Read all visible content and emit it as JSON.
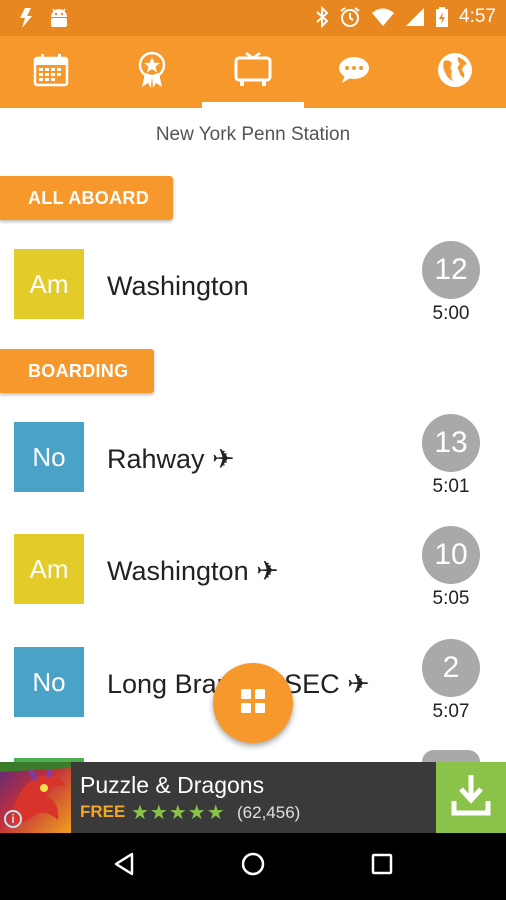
{
  "status_bar": {
    "time": "4:57",
    "left_icons": [
      "notification-icon",
      "android-icon"
    ],
    "right_icons": [
      "bluetooth-icon",
      "alarm-icon",
      "wifi-icon",
      "signal-icon",
      "battery-charging-icon"
    ]
  },
  "tabs": [
    {
      "icon": "calendar-icon",
      "active": false
    },
    {
      "icon": "badge-icon",
      "active": false
    },
    {
      "icon": "tv-icon",
      "active": true
    },
    {
      "icon": "chat-icon",
      "active": false
    },
    {
      "icon": "globe-icon",
      "active": false
    }
  ],
  "station": "New York Penn Station",
  "sections": {
    "all_aboard": "ALL ABOARD",
    "boarding": "BOARDING"
  },
  "trains": [
    {
      "carrier": "Am",
      "carrier_color": "#e3cb2a",
      "destination": "Washington",
      "track": "12",
      "time": "5:00",
      "section": "all_aboard"
    },
    {
      "carrier": "No",
      "carrier_color": "#4aa3c7",
      "destination": "Rahway ✈",
      "track": "13",
      "time": "5:01",
      "section": "boarding"
    },
    {
      "carrier": "Am",
      "carrier_color": "#e3cb2a",
      "destination": "Washington ✈",
      "track": "10",
      "time": "5:05",
      "section": "boarding"
    },
    {
      "carrier": "No",
      "carrier_color": "#4aa3c7",
      "destination": "Long Branch - SEC ✈",
      "track": "2",
      "time": "5:07",
      "section": "boarding"
    }
  ],
  "fab": {
    "icon": "grid-icon"
  },
  "ad": {
    "title": "Puzzle & Dragons",
    "free": "FREE",
    "rating": 4.5,
    "stars": "★★★★★",
    "reviews": "(62,456)",
    "icon": "download-icon"
  },
  "nav": [
    "back-icon",
    "home-icon",
    "recents-icon"
  ],
  "colors": {
    "accent": "#f7982c",
    "status": "#e8861f",
    "track": "#a9a9a9",
    "ad_green": "#8bc34a"
  }
}
